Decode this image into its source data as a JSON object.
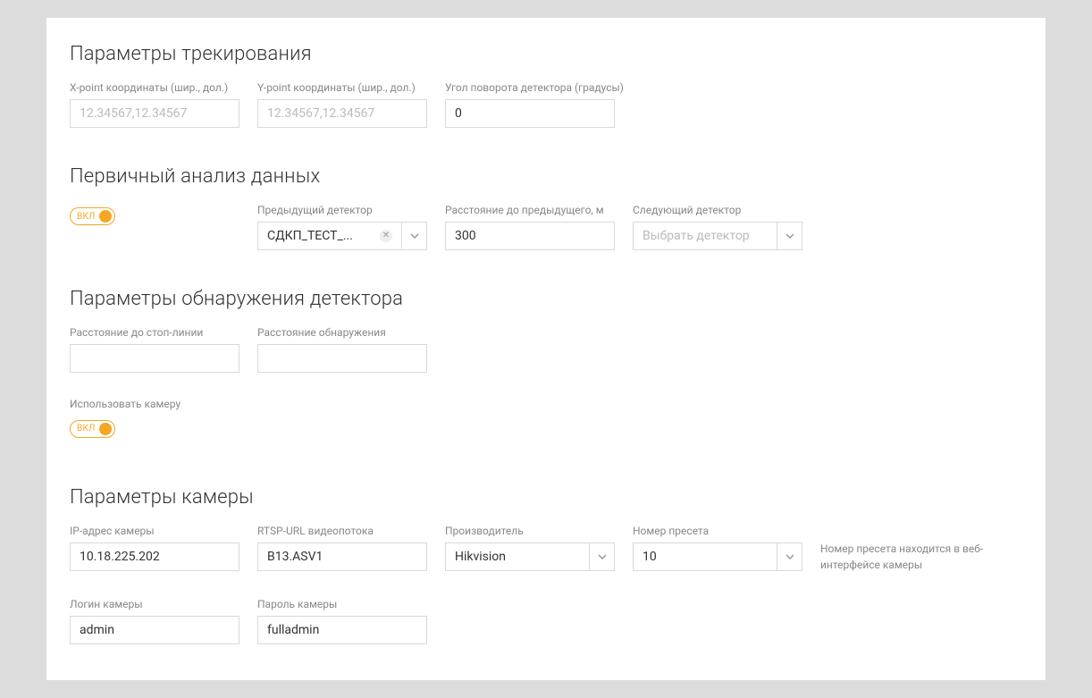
{
  "sections": {
    "tracking": {
      "title": "Параметры трекирования",
      "x_point": {
        "label": "X-point координаты (шир., дол.)",
        "placeholder": "12.34567,12.34567",
        "value": ""
      },
      "y_point": {
        "label": "Y-point координаты (шир., дол.)",
        "placeholder": "12.34567,12.34567",
        "value": ""
      },
      "angle": {
        "label": "Угол поворота детектора (градусы)",
        "value": "0"
      }
    },
    "primary": {
      "title": "Первичный анализ данных",
      "toggle": {
        "label": "вкл",
        "on": true
      },
      "prev_detector": {
        "label": "Предыдущий детектор",
        "value": "СДКП_ТЕСТ_..."
      },
      "distance_prev": {
        "label": "Расстояние до предыдущего, м",
        "value": "300"
      },
      "next_detector": {
        "label": "Следующий детектор",
        "placeholder": "Выбрать детектор"
      }
    },
    "detection": {
      "title": "Параметры обнаружения детектора",
      "stop_line": {
        "label": "Расстояние до стоп-линии",
        "value": ""
      },
      "detection_distance": {
        "label": "Расстояние обнаружения",
        "value": ""
      }
    },
    "use_camera": {
      "label": "Использовать камеру",
      "toggle": {
        "label": "вкл",
        "on": true
      }
    },
    "camera": {
      "title": "Параметры камеры",
      "ip": {
        "label": "IP-адрес камеры",
        "value": "10.18.225.202"
      },
      "rtsp": {
        "label": "RTSP-URL видеопотока",
        "value": "B13.ASV1"
      },
      "vendor": {
        "label": "Производитель",
        "value": "Hikvision"
      },
      "preset": {
        "label": "Номер пресета",
        "value": "10"
      },
      "preset_hint": "Номер пресета находится в веб-интерфейсе камеры",
      "login": {
        "label": "Логин камеры",
        "value": "admin"
      },
      "password": {
        "label": "Пароль камеры",
        "value": "fulladmin"
      }
    }
  }
}
